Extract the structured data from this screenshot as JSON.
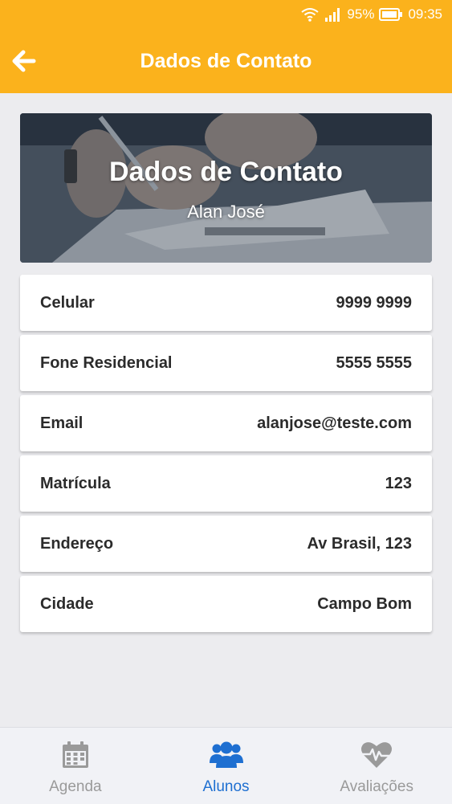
{
  "status_bar": {
    "battery": "95%",
    "time": "09:35"
  },
  "toolbar": {
    "title": "Dados de Contato",
    "back_icon": "arrow-left-icon"
  },
  "banner": {
    "title": "Dados de Contato",
    "subtitle": "Alan José"
  },
  "contact": {
    "rows": [
      {
        "label": "Celular",
        "value": "9999 9999"
      },
      {
        "label": "Fone Residencial",
        "value": "5555 5555"
      },
      {
        "label": "Email",
        "value": "alanjose@teste.com"
      },
      {
        "label": "Matrícula",
        "value": "123"
      },
      {
        "label": "Endereço",
        "value": "Av Brasil, 123"
      },
      {
        "label": "Cidade",
        "value": "Campo Bom"
      }
    ]
  },
  "tabbar": {
    "tabs": [
      {
        "label": "Agenda",
        "icon": "calendar-icon",
        "active": false
      },
      {
        "label": "Alunos",
        "icon": "users-icon",
        "active": true
      },
      {
        "label": "Avaliações",
        "icon": "heart-pulse-icon",
        "active": false
      }
    ]
  },
  "colors": {
    "accent": "#fbb21c",
    "active_tab": "#1e6fd1",
    "inactive_tab": "#9a9a9a",
    "background": "#ececef"
  }
}
